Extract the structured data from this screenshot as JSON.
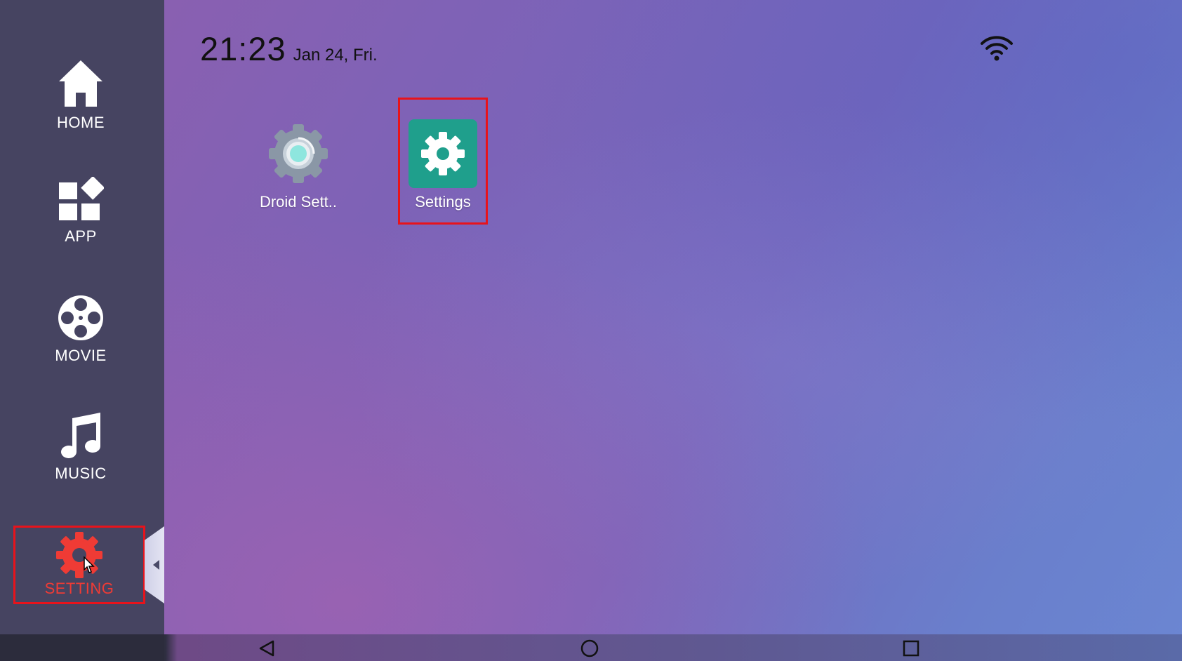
{
  "status": {
    "time": "21:23",
    "date": "Jan 24, Fri.",
    "wifi_icon": "wifi-icon"
  },
  "sidebar": {
    "items": [
      {
        "label": "HOME",
        "icon": "home-icon"
      },
      {
        "label": "APP",
        "icon": "apps-icon"
      },
      {
        "label": "MOVIE",
        "icon": "film-reel-icon"
      },
      {
        "label": "MUSIC",
        "icon": "music-note-icon"
      },
      {
        "label": "SETTING",
        "icon": "gear-icon",
        "active": true
      }
    ],
    "active_color": "#ef3b35"
  },
  "apps": [
    {
      "label": "Droid Sett..",
      "icon": "droid-settings-gear-icon"
    },
    {
      "label": "Settings",
      "icon": "settings-gear-icon",
      "selected": true
    }
  ],
  "system_nav": {
    "buttons": [
      "back-icon",
      "home-circle-icon",
      "recents-square-icon"
    ]
  },
  "colors": {
    "sidebar_bg": "#464461",
    "settings_tile": "#1f9f8c",
    "highlight_box": "#e8131b"
  }
}
